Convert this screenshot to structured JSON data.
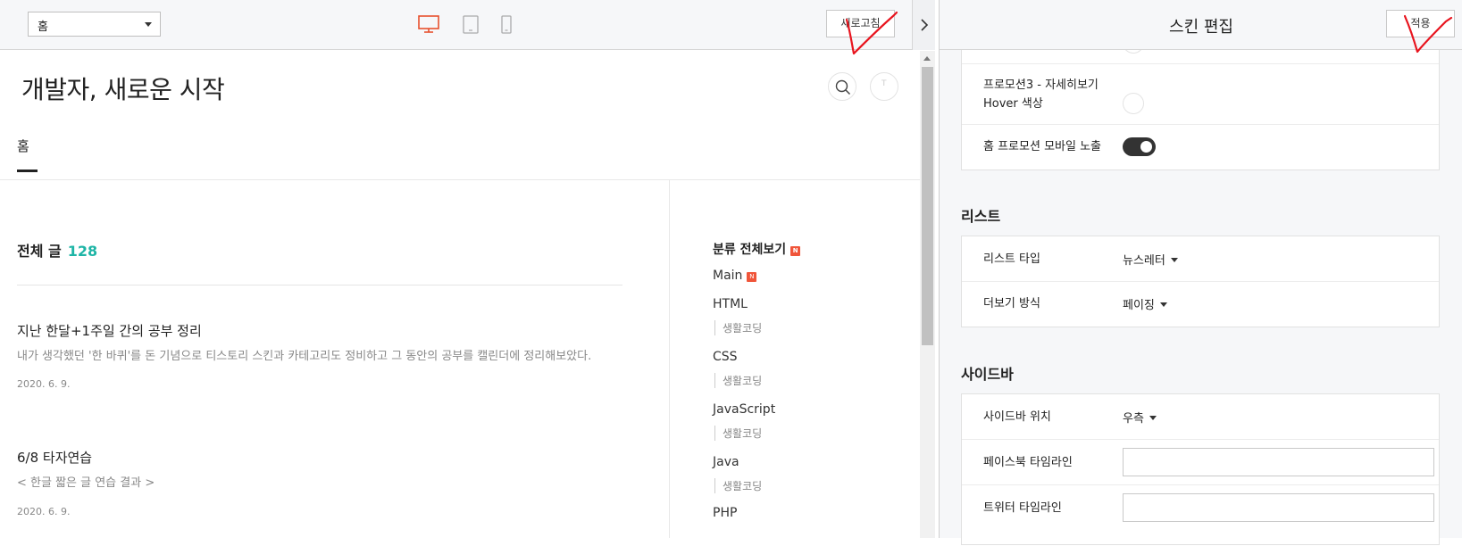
{
  "toolbar": {
    "page_select": "홈",
    "refresh_label": "새로고침"
  },
  "blog": {
    "title": "개발자, 새로운 시작",
    "nav_home": "홈",
    "all_posts_label": "전체 글",
    "all_posts_count": "128",
    "posts": [
      {
        "title": "지난 한달+1주일 간의 공부 정리",
        "desc": "내가 생각했던 '한 바퀴'를 돈 기념으로 티스토리 스킨과 카테고리도 정비하고 그 동안의 공부를 캘린더에 정리해보았다.",
        "date": "2020. 6. 9."
      },
      {
        "title": "6/8 타자연습",
        "desc": "< 한글 짧은 글 연습 결과 >",
        "date": "2020. 6. 9."
      }
    ],
    "categories": {
      "all_label": "분류 전체보기",
      "new_badge": "N",
      "items": [
        {
          "label": "Main",
          "sub": ""
        },
        {
          "label": "HTML",
          "sub": "생활코딩"
        },
        {
          "label": "CSS",
          "sub": "생활코딩"
        },
        {
          "label": "JavaScript",
          "sub": "생활코딩"
        },
        {
          "label": "Java",
          "sub": "생활코딩"
        },
        {
          "label": "PHP",
          "sub": ""
        }
      ]
    }
  },
  "editor": {
    "title": "스킨 편집",
    "apply_label": "적용",
    "promo": {
      "hover_color_label": "프로모션3 - 자세히보기 Hover 색상",
      "mobile_label": "홈 프로모션 모바일 노출"
    },
    "list_section": {
      "title": "리스트",
      "type_label": "리스트 타입",
      "type_value": "뉴스레터",
      "more_label": "더보기 방식",
      "more_value": "페이징"
    },
    "sidebar_section": {
      "title": "사이드바",
      "position_label": "사이드바 위치",
      "position_value": "우측",
      "facebook_label": "페이스북 타임라인",
      "twitter_label": "트위터 타임라인"
    }
  },
  "colors": {
    "accent_teal": "#1eb5a6",
    "device_active": "#e8502e",
    "new_badge": "#f0553a",
    "annotation_red": "#e8141e"
  },
  "icons": {
    "desktop": "desktop-icon",
    "tablet": "tablet-icon",
    "mobile": "mobile-icon",
    "search": "search-icon",
    "collapse": "chevron-right-icon"
  }
}
